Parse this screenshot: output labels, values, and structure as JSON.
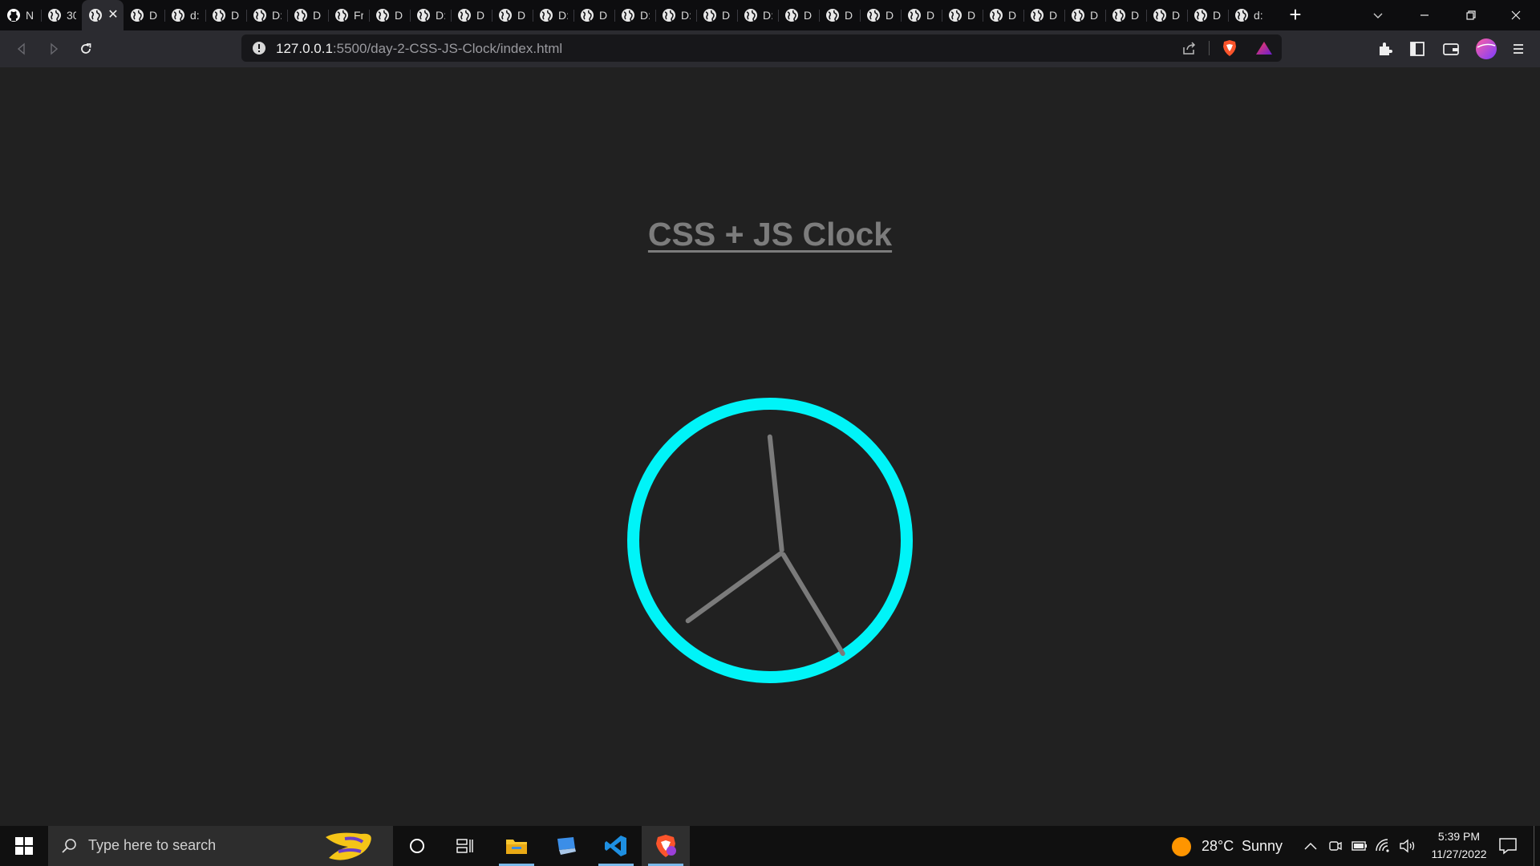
{
  "browser": {
    "tabs": [
      {
        "label": "N",
        "icon": "github-icon"
      },
      {
        "label": "30",
        "icon": "globe-icon"
      },
      {
        "label": "",
        "icon": "globe-icon",
        "active": true
      },
      {
        "label": "D",
        "icon": "globe-icon"
      },
      {
        "label": "d:",
        "icon": "globe-icon"
      },
      {
        "label": "D",
        "icon": "globe-icon"
      },
      {
        "label": "D:",
        "icon": "globe-icon"
      },
      {
        "label": "D",
        "icon": "globe-icon"
      },
      {
        "label": "Fr",
        "icon": "globe-icon"
      },
      {
        "label": "D",
        "icon": "globe-icon"
      },
      {
        "label": "D:",
        "icon": "globe-icon"
      },
      {
        "label": "D",
        "icon": "globe-icon"
      },
      {
        "label": "D",
        "icon": "globe-icon"
      },
      {
        "label": "D:",
        "icon": "globe-icon"
      },
      {
        "label": "D",
        "icon": "globe-icon"
      },
      {
        "label": "D:",
        "icon": "globe-icon"
      },
      {
        "label": "D:",
        "icon": "globe-icon"
      },
      {
        "label": "D",
        "icon": "globe-icon"
      },
      {
        "label": "D:",
        "icon": "globe-icon"
      },
      {
        "label": "D",
        "icon": "globe-icon"
      },
      {
        "label": "D",
        "icon": "globe-icon"
      },
      {
        "label": "D",
        "icon": "globe-icon"
      },
      {
        "label": "D",
        "icon": "globe-icon"
      },
      {
        "label": "D",
        "icon": "globe-icon"
      },
      {
        "label": "D",
        "icon": "globe-icon"
      },
      {
        "label": "D",
        "icon": "globe-icon"
      },
      {
        "label": "D",
        "icon": "globe-icon"
      },
      {
        "label": "D",
        "icon": "globe-icon"
      },
      {
        "label": "D",
        "icon": "globe-icon"
      },
      {
        "label": "D",
        "icon": "globe-icon"
      },
      {
        "label": "d:",
        "icon": "globe-icon"
      }
    ],
    "url_host": "127.0.0.1",
    "url_path": ":5500/day-2-CSS-JS-Clock/index.html"
  },
  "page": {
    "title": "CSS + JS Clock",
    "clock": {
      "ring_color": "#00f4f8",
      "hand_color": "#7b7b7b",
      "hand_angles_deg": {
        "hour": 234,
        "minute": -6,
        "second": 149
      }
    }
  },
  "taskbar": {
    "search_placeholder": "Type here to search",
    "weather_temp": "28°C",
    "weather_desc": "Sunny",
    "time": "5:39 PM",
    "date": "11/27/2022"
  }
}
